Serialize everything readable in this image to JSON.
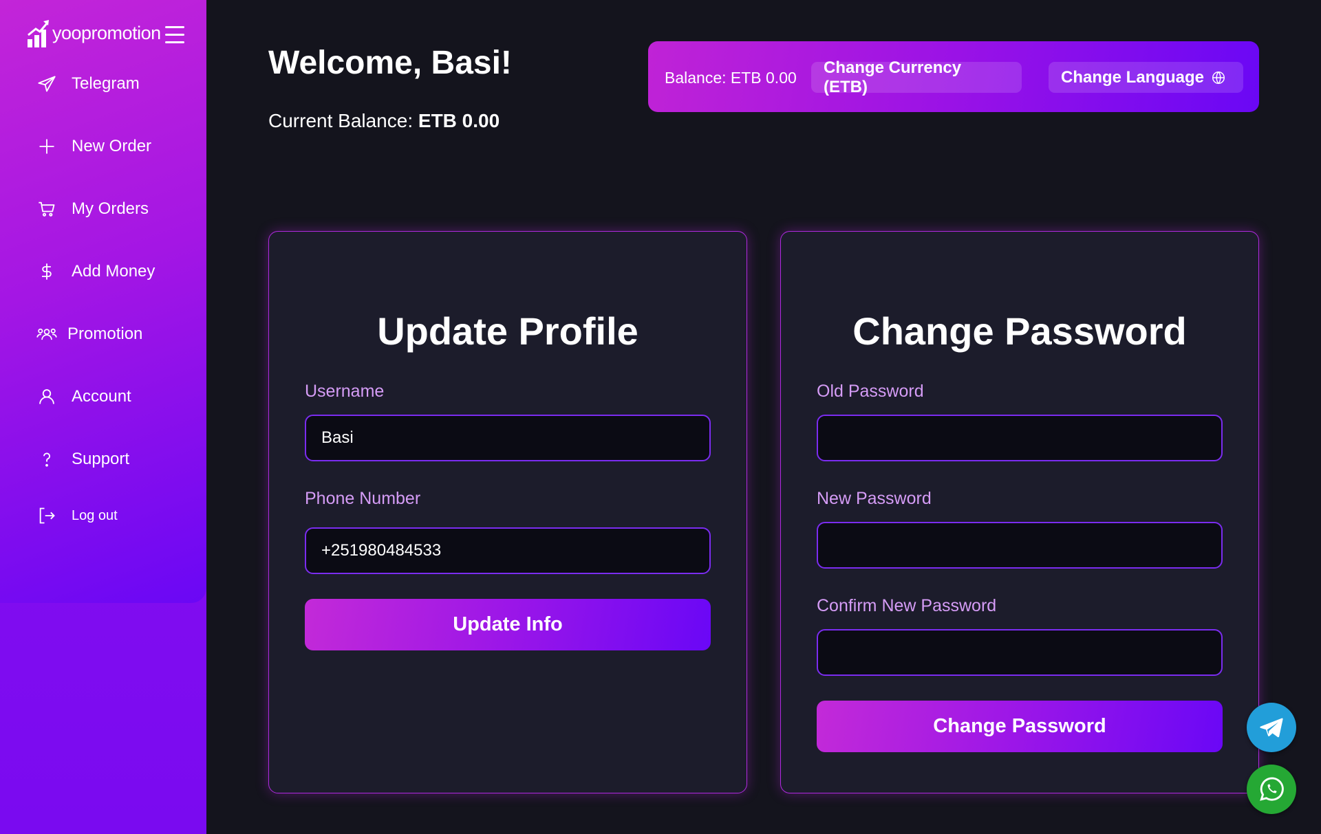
{
  "brand": {
    "name": "yoopromotion"
  },
  "sidebar": {
    "items": [
      {
        "label": "Telegram",
        "icon": "send-icon"
      },
      {
        "label": "New Order",
        "icon": "plus-icon"
      },
      {
        "label": "My Orders",
        "icon": "cart-icon"
      },
      {
        "label": "Add Money",
        "icon": "dollar-icon"
      },
      {
        "label": "Promotion",
        "icon": "users-icon"
      },
      {
        "label": "Account",
        "icon": "user-icon"
      },
      {
        "label": "Support",
        "icon": "question-icon"
      },
      {
        "label": "Log out",
        "icon": "logout-icon"
      }
    ]
  },
  "header": {
    "welcome": "Welcome, Basi!",
    "current_balance_label": "Current Balance:",
    "current_balance_value": "ETB 0.00"
  },
  "topbar": {
    "balance": "Balance: ETB 0.00",
    "change_currency": "Change Currency (ETB)",
    "change_language": "Change Language"
  },
  "profile": {
    "title": "Update Profile",
    "username_label": "Username",
    "username_value": "Basi",
    "phone_label": "Phone Number",
    "phone_value": "+251980484533",
    "submit": "Update Info"
  },
  "password": {
    "title": "Change Password",
    "old_label": "Old Password",
    "new_label": "New Password",
    "confirm_label": "Confirm New Password",
    "submit": "Change Password"
  },
  "colors": {
    "accent_start": "#c023d6",
    "accent_end": "#6a07f5",
    "background": "#14141d",
    "card": "#1c1c2b",
    "label": "#d59cf6",
    "telegram": "#229ed9",
    "whatsapp": "#25a834"
  }
}
